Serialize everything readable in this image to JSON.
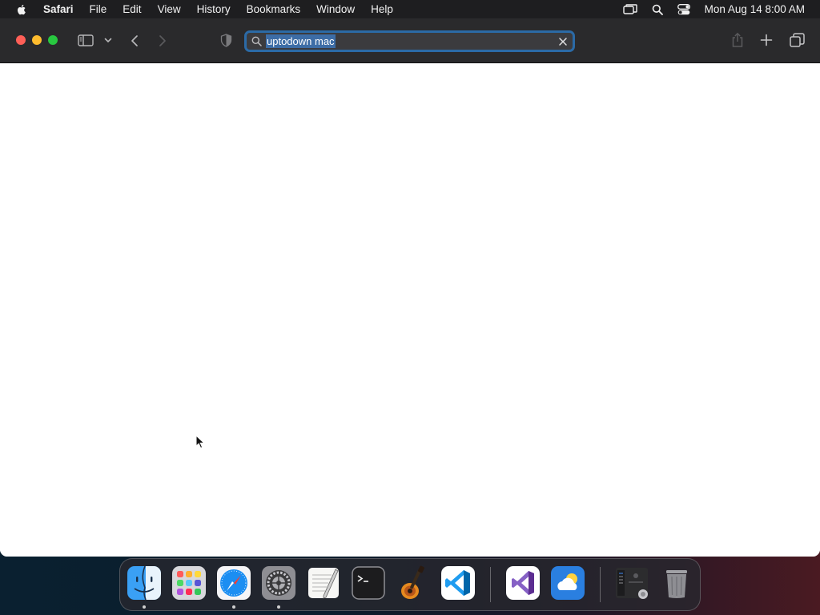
{
  "menubar": {
    "app_name": "Safari",
    "menus": [
      "File",
      "Edit",
      "View",
      "History",
      "Bookmarks",
      "Window",
      "Help"
    ],
    "clock": "Mon Aug 14  8:00 AM"
  },
  "browser": {
    "address_bar": {
      "value": "uptodown mac",
      "state": "text selected"
    }
  },
  "dock": {
    "apps": [
      {
        "name": "Finder",
        "icon": "finder-icon",
        "running": true
      },
      {
        "name": "Launchpad",
        "icon": "launchpad-icon",
        "running": false
      },
      {
        "name": "Safari",
        "icon": "safari-icon",
        "running": true
      },
      {
        "name": "System Settings",
        "icon": "system-settings-icon",
        "running": true
      },
      {
        "name": "TextEdit",
        "icon": "textedit-icon",
        "running": false
      },
      {
        "name": "Terminal",
        "icon": "terminal-icon",
        "running": false
      },
      {
        "name": "GarageBand",
        "icon": "garageband-icon",
        "running": false
      },
      {
        "name": "Visual Studio Code",
        "icon": "vscode-icon",
        "running": false
      },
      {
        "name": "Visual Studio",
        "icon": "visual-studio-icon",
        "running": false
      },
      {
        "name": "Weather",
        "icon": "weather-icon",
        "running": false
      },
      {
        "name": "Downloads",
        "icon": "downloads-stack-icon",
        "running": false
      },
      {
        "name": "Trash",
        "icon": "trash-icon",
        "running": false
      }
    ]
  },
  "colors": {
    "menubar_bg": "#1e1e20",
    "toolbar_bg": "#2a2a2c",
    "address_focus_ring": "#2b6aa6",
    "selection_bg": "#3d6da6",
    "close": "#ff5f57",
    "minimize": "#febc2e",
    "zoom": "#28c840"
  }
}
